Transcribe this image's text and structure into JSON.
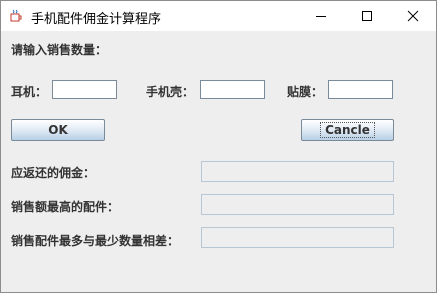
{
  "window": {
    "title": "手机配件佣金计算程序",
    "icon": "java-cup-icon",
    "controls": [
      "minimize-icon",
      "maximize-icon",
      "close-icon"
    ]
  },
  "form": {
    "prompt": "请输入销售数量：",
    "fields": [
      {
        "label": "耳机：",
        "value": ""
      },
      {
        "label": "手机壳：",
        "value": ""
      },
      {
        "label": "贴膜：",
        "value": ""
      }
    ],
    "ok_label": "OK",
    "cancel_label": "Cancle"
  },
  "results": [
    {
      "label": "应返还的佣金：",
      "value": ""
    },
    {
      "label": "销售额最高的配件：",
      "value": ""
    },
    {
      "label": "销售配件最多与最少数量相差：",
      "value": ""
    }
  ]
}
